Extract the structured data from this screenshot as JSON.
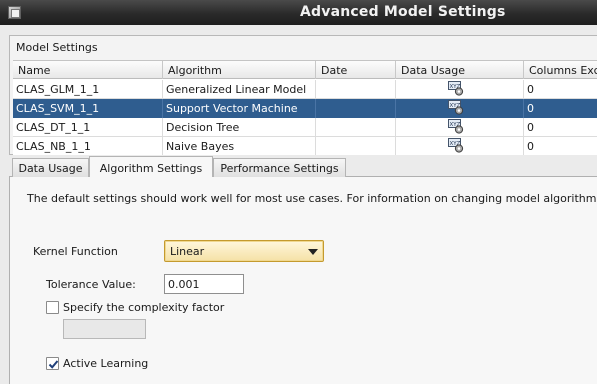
{
  "window": {
    "title": "Advanced Model Settings",
    "icon": "app-window-icon"
  },
  "model_settings": {
    "title": "Model Settings",
    "columns": [
      "Name",
      "Algorithm",
      "Date",
      "Data Usage",
      "Columns Exc"
    ],
    "rows": [
      {
        "name": "CLAS_GLM_1_1",
        "algorithm": "Generalized Linear Model",
        "date": "",
        "data_usage_icon": "xyz-data-usage-icon",
        "columns_excluded": "0",
        "selected": false
      },
      {
        "name": "CLAS_SVM_1_1",
        "algorithm": "Support Vector Machine",
        "date": "",
        "data_usage_icon": "xyz-data-usage-icon",
        "columns_excluded": "0",
        "selected": true
      },
      {
        "name": "CLAS_DT_1_1",
        "algorithm": "Decision Tree",
        "date": "",
        "data_usage_icon": "xyz-data-usage-icon",
        "columns_excluded": "0",
        "selected": false
      },
      {
        "name": "CLAS_NB_1_1",
        "algorithm": "Naive Bayes",
        "date": "",
        "data_usage_icon": "xyz-data-usage-icon",
        "columns_excluded": "0",
        "selected": false
      }
    ]
  },
  "tabs": [
    {
      "label": "Data Usage",
      "active": false
    },
    {
      "label": "Algorithm Settings",
      "active": true
    },
    {
      "label": "Performance Settings",
      "active": false
    }
  ],
  "algorithm_settings": {
    "info": "The default settings should work well for most use cases. For information on changing model algorithm set",
    "kernel_function_label": "Kernel Function",
    "kernel_function_value": "Linear",
    "tolerance_label": "Tolerance Value:",
    "tolerance_value": "0.001",
    "complexity_label": "Specify the complexity factor",
    "complexity_checked": false,
    "complexity_value": "",
    "active_learning_label": "Active Learning",
    "active_learning_checked": true
  },
  "colors": {
    "selection": "#2f5d8f",
    "title_bar": "#2a2a2a",
    "dropdown_highlight": "#f5e1a6"
  }
}
